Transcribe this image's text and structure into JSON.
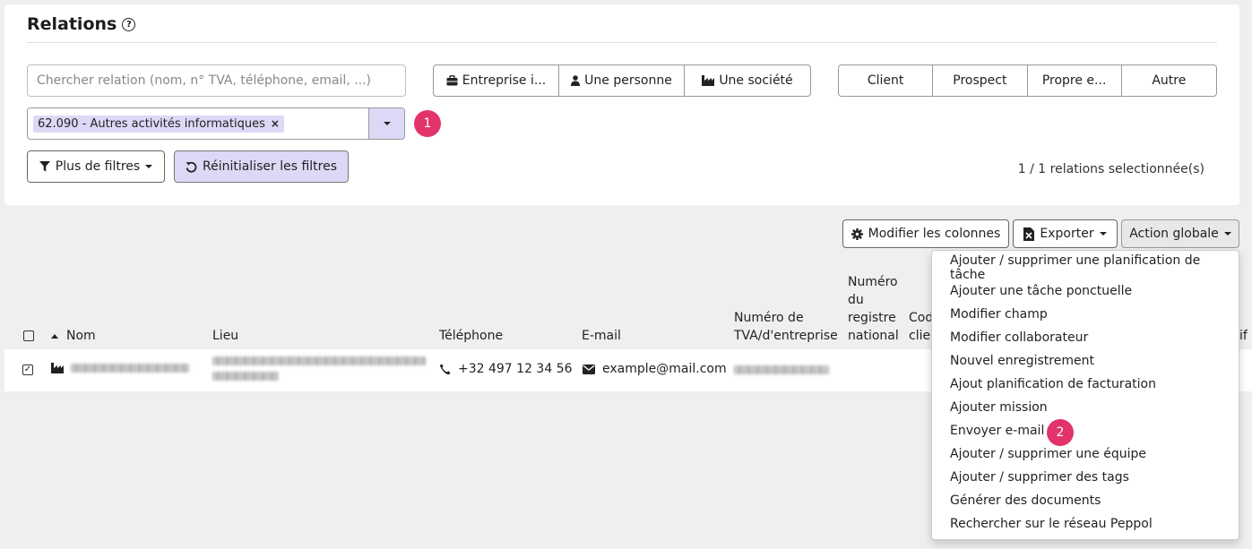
{
  "page": {
    "title": "Relations",
    "help_icon": "question-circle-icon"
  },
  "search": {
    "placeholder": "Chercher relation (nom, n° TVA, téléphone, email, ...)",
    "value": ""
  },
  "type_filter": [
    {
      "label": "Entreprise i...",
      "icon": "briefcase-icon"
    },
    {
      "label": "Une personne",
      "icon": "user-icon"
    },
    {
      "label": "Une société",
      "icon": "factory-icon"
    }
  ],
  "category_filter": [
    "Client",
    "Prospect",
    "Propre e...",
    "Autre"
  ],
  "activity_filter": {
    "selected_tag": "62.090 - Autres activités informatiques",
    "remove_symbol": "×"
  },
  "badges": {
    "first": "1",
    "second": "2"
  },
  "filters": {
    "more_filters": "Plus de filtres",
    "reset": "Réinitialiser les filtres"
  },
  "selection_count": "1 / 1 relations selectionnée(s)",
  "toolbar": {
    "columns": "Modifier les colonnes",
    "export": "Exporter",
    "global_action": "Action globale"
  },
  "table": {
    "headers": {
      "name": "Nom",
      "place": "Lieu",
      "phone": "Téléphone",
      "email": "E-mail",
      "vat_line1": "Numéro de",
      "vat_line2": "TVA/d'entreprise",
      "nat_line1": "Numéro",
      "nat_line2": "du",
      "nat_line3": "registre",
      "nat_line4": "national",
      "code_line1": "Cod",
      "code_line2": "clie",
      "last": "if"
    },
    "rows": [
      {
        "phone": "+32 497 12 34 56",
        "email": "example@mail.com",
        "checked": true
      }
    ]
  },
  "global_action_menu": [
    "Ajouter / supprimer une planification de tâche",
    "Ajouter une tâche ponctuelle",
    "Modifier champ",
    "Modifier collaborateur",
    "Nouvel enregistrement",
    "Ajout planification de facturation",
    "Ajouter mission",
    "Envoyer e-mail",
    "Ajouter / supprimer une équipe",
    "Ajouter / supprimer des tags",
    "Générer des documents",
    "Rechercher sur le réseau Peppol"
  ],
  "colors": {
    "accent_purple": "#dcd9f6",
    "badge_pink": "#e2336b"
  }
}
